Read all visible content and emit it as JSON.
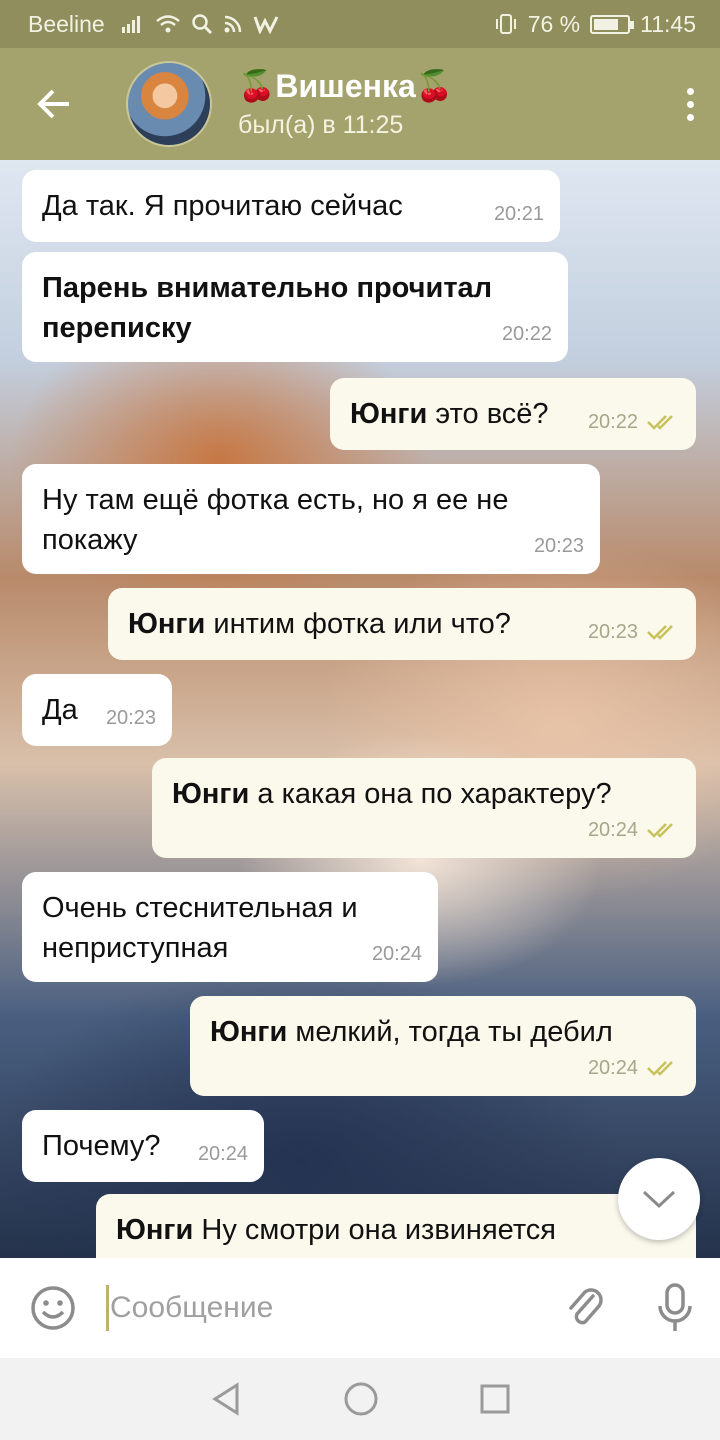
{
  "status_bar": {
    "carrier": "Beeline",
    "battery": "76 %",
    "battery_level": 0.76,
    "time": "11:45"
  },
  "header": {
    "title": "Вишенка",
    "status": "был(а) в 11:25"
  },
  "messages": [
    {
      "dir": "in",
      "sender": "",
      "text": "Да так. Я прочитаю сейчас",
      "time": "20:21"
    },
    {
      "dir": "in",
      "sender": "",
      "text": "Парень внимательно прочитал переписку",
      "time": "20:22",
      "bold": true
    },
    {
      "dir": "out",
      "sender": "Юнги",
      "text": "это всё?",
      "time": "20:22"
    },
    {
      "dir": "in",
      "sender": "",
      "text": "Ну там ещё фотка есть, но я ее не покажу",
      "time": "20:23"
    },
    {
      "dir": "out",
      "sender": "Юнги",
      "text": "интим фотка или что?",
      "time": "20:23"
    },
    {
      "dir": "in",
      "sender": "",
      "text": "Да",
      "time": "20:23"
    },
    {
      "dir": "out",
      "sender": "Юнги",
      "text": "а какая она по характеру?",
      "time": "20:24"
    },
    {
      "dir": "in",
      "sender": "",
      "text": "Очень стеснительная и неприступная",
      "time": "20:24"
    },
    {
      "dir": "out",
      "sender": "Юнги",
      "text": "мелкий, тогда ты дебил",
      "time": "20:24"
    },
    {
      "dir": "in",
      "sender": "",
      "text": "Почему?",
      "time": "20:24"
    },
    {
      "dir": "out",
      "sender": "Юнги",
      "text": "Ну смотри она извиняется",
      "time": ""
    }
  ],
  "input": {
    "placeholder": "Сообщение"
  },
  "colors": {
    "header": "#a5a36d",
    "status_bar": "#8f8e5c",
    "outgoing_bubble": "#fbf8ec",
    "incoming_bubble": "#ffffff",
    "read_ticks": "#c7c25a"
  },
  "icons": {
    "back": "arrow-left-icon",
    "menu": "more-vertical-icon",
    "emoji": "smile-icon",
    "attach": "paperclip-icon",
    "mic": "microphone-icon",
    "scroll": "chevron-down-icon"
  }
}
